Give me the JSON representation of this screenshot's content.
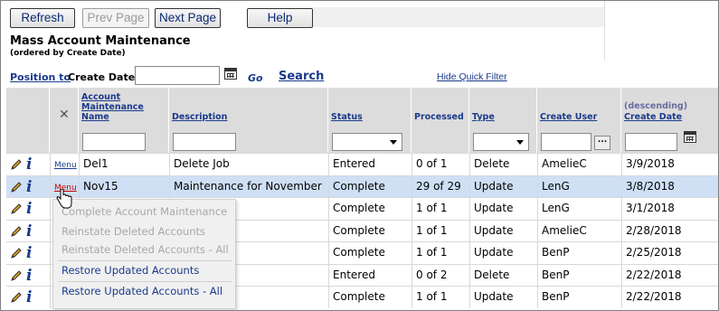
{
  "toolbar": {
    "refresh": "Refresh",
    "prev_page": "Prev Page",
    "next_page": "Next Page",
    "help": "Help"
  },
  "page": {
    "title": "Mass Account Maintenance",
    "subtitle": "(ordered by Create Date)"
  },
  "position_bar": {
    "position_to": "Position to",
    "field_label": "Create Date",
    "go": "Go",
    "search": "Search",
    "hide_quick_filter": "Hide Quick Filter"
  },
  "columns": {
    "account_maintenance_name_1": "Account",
    "account_maintenance_name_2": "Maintenance",
    "account_maintenance_name_3": "Name",
    "description": "Description",
    "status": "Status",
    "processed": "Processed",
    "type": "Type",
    "create_user": "Create User",
    "create_date_note": "(descending)",
    "create_date": "Create Date",
    "dots": "..."
  },
  "menu_label": "Menu",
  "rows": [
    {
      "name": "Del1",
      "description": "Delete Job",
      "status": "Entered",
      "processed": "0 of 1",
      "type": "Delete",
      "user": "AmelieC",
      "date": "3/9/2018"
    },
    {
      "name": "Nov15",
      "description": "Maintenance for November",
      "status": "Complete",
      "processed": "29 of 29",
      "type": "Update",
      "user": "LenG",
      "date": "3/8/2018"
    },
    {
      "name": "",
      "description": "",
      "status": "Complete",
      "processed": "1 of 1",
      "type": "Update",
      "user": "LenG",
      "date": "3/1/2018"
    },
    {
      "name": "",
      "description": "",
      "status": "Complete",
      "processed": "1 of 1",
      "type": "Update",
      "user": "AmelieC",
      "date": "2/28/2018"
    },
    {
      "name": "",
      "description": "",
      "status": "Complete",
      "processed": "1 of 1",
      "type": "Update",
      "user": "BenP",
      "date": "2/25/2018"
    },
    {
      "name": "",
      "description": "",
      "status": "Entered",
      "processed": "0 of 2",
      "type": "Delete",
      "user": "BenP",
      "date": "2/22/2018"
    },
    {
      "name": "",
      "description": "",
      "status": "Complete",
      "processed": "1 of 1",
      "type": "Update",
      "user": "BenP",
      "date": "2/22/2018"
    }
  ],
  "popup_menu": {
    "complete": "Complete Account Maintenance",
    "reinstate": "Reinstate Deleted Accounts",
    "reinstate_all": "Reinstate Deleted Accounts - All",
    "restore": "Restore Updated Accounts",
    "restore_all": "Restore Updated Accounts - All"
  }
}
